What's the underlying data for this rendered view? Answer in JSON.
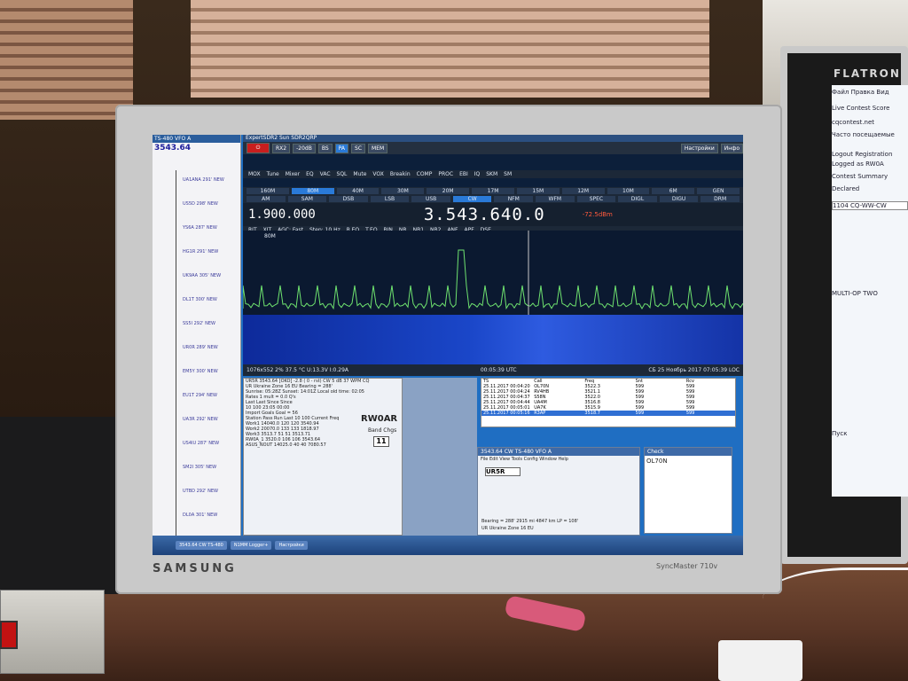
{
  "monitor_left": {
    "brand": "SAMSUNG",
    "model": "SyncMaster 710v"
  },
  "monitor_right": {
    "brand": "FLATRON",
    "lines": [
      "Файл  Правка  Вид",
      "Live Contest Score",
      "cqcontest.net",
      "Часто посещаемые",
      "Logout   Registration",
      "Logged as RW0A",
      "Contest  Summary",
      "Declared",
      "1104 CQ-WW-CW",
      "MULTI-OP  TWO",
      "Пуск"
    ]
  },
  "bandmap": {
    "title": "TS-480 VFO A",
    "freq": "3543.64",
    "spots": [
      "UA1ANA 291' NEW",
      "US5D 298' NEW",
      "YS6A 287' NEW",
      "HG1R 291' NEW",
      "UK9AA 305' NEW",
      "DL1T 300' NEW",
      "SS5I 292' NEW",
      "UR0R 289' NEW",
      "EM5Y 300' NEW",
      "EU1T 294' NEW",
      "UA3R 292' NEW",
      "US4IU 287' NEW",
      "SM2I 305' NEW",
      "UTBD 292' NEW",
      "DL0A 301' NEW"
    ]
  },
  "sdr": {
    "title": "ExpertSDR2 Sun SDR2QRP",
    "toolbar": [
      "RX2",
      "-20dB",
      "BS",
      "PA",
      "SC",
      "MEM",
      "Настройки",
      "Инфо"
    ],
    "modes_row": [
      "MOX",
      "Tune",
      "Mixer",
      "EQ",
      "VAC",
      "SQL",
      "Mute",
      "VOX",
      "Breakin",
      "COMP",
      "PROC",
      "EBI",
      "IQ",
      "SKM",
      "SM"
    ],
    "bands": [
      "160M",
      "80M",
      "40M",
      "30M",
      "20M",
      "17M",
      "15M",
      "12M",
      "10M",
      "6M",
      "GEN"
    ],
    "modes": [
      "AM",
      "SAM",
      "DSB",
      "LSB",
      "USB",
      "CW",
      "NFM",
      "WFM",
      "SPEC",
      "DIGL",
      "DIGU",
      "DRM"
    ],
    "vfo_b": "1.900.000",
    "vfo_a": "3.543.640.0",
    "smeter": "-72.5dBm",
    "filters": [
      "RIT",
      "XIT",
      "AGC: Fast",
      "Step: 10 Hz",
      "R.EQ",
      "T.EQ",
      "BIN",
      "NR",
      "NB1",
      "NB2",
      "ANF",
      "APF",
      "DSE"
    ],
    "spectrum_label": "80M",
    "status": {
      "left": "1076x552  2%  37.5 °C  U:13.3V I:0.29A",
      "center": "00:05:39 UTC",
      "right": "СБ 25 Ноябрь 2017   07:05:39 LOC"
    }
  },
  "info": {
    "lines": [
      "UR5R  3543.64 [OKO]  -2.8 ( 0 - rst) CW 5 dB 37 WPM CQ",
      "UR  Ukraine  Zone 16  EU  Bearing = 288'",
      "Sunrise: 05:28Z  Sunset: 14:01Z  Local old time: 02:05",
      "Rates  1 mult = 0.0 Q's",
      "Last  Last  Since  Since",
      "10  100  23:05  00:00",
      "Import Goals  Goal = 56",
      "Station  Pass  Run  Last 10  100  Current Freq",
      "Work1  14040.0  120  120  3540.94",
      "Work2  20070.0  133  133  1818.97",
      "Work3  3513.7  51  51  3513.71",
      "RW0A_1  3520.0  106  106  3543.64",
      "ASUS_NOUT  14025.0  40  40  7080.57"
    ],
    "callsign": "RW0AR",
    "band_chgs_label": "Band Chgs",
    "band_chgs": "11"
  },
  "log": {
    "header": [
      "TS",
      "Call",
      "Freq",
      "Snt",
      "Rcv"
    ],
    "rows": [
      [
        "25.11.2017 00:04:20",
        "OL70N",
        "3522.3",
        "599",
        "599"
      ],
      [
        "25.11.2017 00:04:24",
        "RV4HB",
        "3521.1",
        "599",
        "599"
      ],
      [
        "25.11.2017 00:04:37",
        "S58N",
        "3522.0",
        "599",
        "599"
      ],
      [
        "25.11.2017 00:04:44",
        "UA4M",
        "3516.8",
        "599",
        "599"
      ],
      [
        "25.11.2017 00:05:01",
        "UA7K",
        "3515.9",
        "599",
        "599"
      ],
      [
        "25.11.2017 00:05:16",
        "R3AP",
        "3518.7",
        "599",
        "599"
      ]
    ]
  },
  "entry": {
    "title": "3543.64 CW TS-480 VFO A",
    "call": "UR5R",
    "menu": "File  Edit  View  Tools  Config  Window  Help",
    "bearing": "Bearing = 288'  2915 mi  4847 km  LP = 108'",
    "country": "UR  Ukraine  Zone 16  EU"
  },
  "check": {
    "title": "Check",
    "call": "OL70N"
  },
  "taskbar": [
    "3543.64 CW TS-480",
    "N1MM Logger+",
    "Настройки"
  ]
}
